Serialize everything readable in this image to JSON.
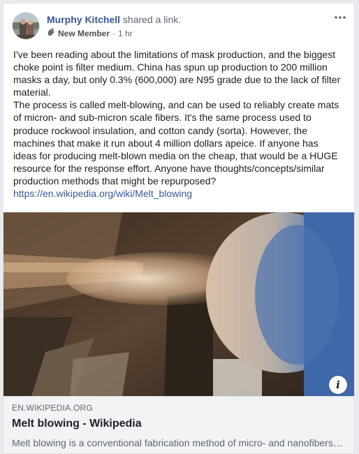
{
  "post": {
    "author": "Murphy Kitchell",
    "action_prefix": "shared a",
    "action_link": "link.",
    "badge": "New Member",
    "separator": "·",
    "time": "1 hr",
    "paragraph1": "I've been reading about the limitations of mask production, and the biggest choke point is filter medium. China has spun up production to 200 million masks a day, but only 0.3% (600,000) are N95 grade due to the lack of filter material.",
    "paragraph2": "The process is called melt-blowing, and can be used to reliably create mats of micron- and sub-micron scale fibers. It's the same process used to produce rockwool insulation, and cotton candy (sorta). However, the machines that make it run about 4 million dollars apeice. If anyone has ideas for producing melt-blown media on the cheap, that would be a HUGE resource for the response effort. Anyone have thoughts/concepts/similar production methods that might be repurposed?",
    "url": "https://en.wikipedia.org/wiki/Melt_blowing"
  },
  "link_preview": {
    "domain": "EN.WIKIPEDIA.ORG",
    "title": "Melt blowing - Wikipedia",
    "description": "Melt blowing is a conventional fabrication method of micro- and nanofibers where a polymer melt is extruded through small nozzles",
    "info_icon": "i"
  },
  "icons": {
    "more": "more-horizontal-icon",
    "badge": "new-member-wave-icon",
    "info": "info-icon"
  },
  "colors": {
    "link": "#385898",
    "background": "#e9ebee",
    "preview_footer": "#f2f3f5"
  }
}
